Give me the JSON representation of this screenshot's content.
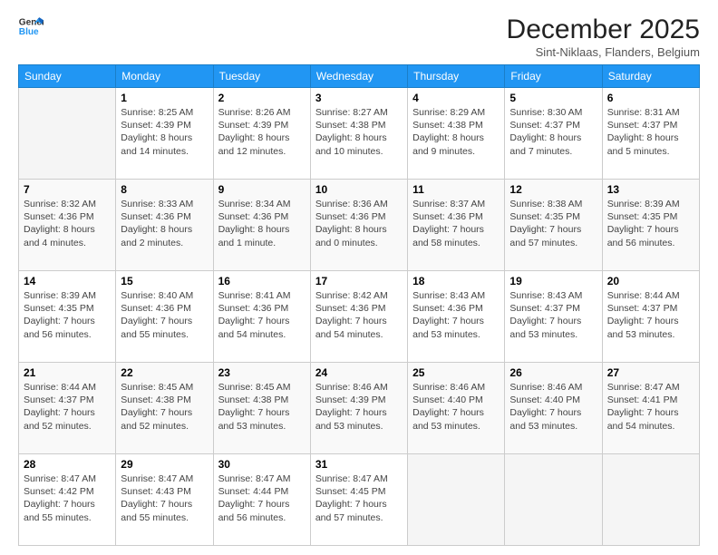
{
  "header": {
    "logo_line1": "General",
    "logo_line2": "Blue",
    "month": "December 2025",
    "location": "Sint-Niklaas, Flanders, Belgium"
  },
  "days_of_week": [
    "Sunday",
    "Monday",
    "Tuesday",
    "Wednesday",
    "Thursday",
    "Friday",
    "Saturday"
  ],
  "weeks": [
    [
      {
        "day": "",
        "info": ""
      },
      {
        "day": "1",
        "info": "Sunrise: 8:25 AM\nSunset: 4:39 PM\nDaylight: 8 hours\nand 14 minutes."
      },
      {
        "day": "2",
        "info": "Sunrise: 8:26 AM\nSunset: 4:39 PM\nDaylight: 8 hours\nand 12 minutes."
      },
      {
        "day": "3",
        "info": "Sunrise: 8:27 AM\nSunset: 4:38 PM\nDaylight: 8 hours\nand 10 minutes."
      },
      {
        "day": "4",
        "info": "Sunrise: 8:29 AM\nSunset: 4:38 PM\nDaylight: 8 hours\nand 9 minutes."
      },
      {
        "day": "5",
        "info": "Sunrise: 8:30 AM\nSunset: 4:37 PM\nDaylight: 8 hours\nand 7 minutes."
      },
      {
        "day": "6",
        "info": "Sunrise: 8:31 AM\nSunset: 4:37 PM\nDaylight: 8 hours\nand 5 minutes."
      }
    ],
    [
      {
        "day": "7",
        "info": "Sunrise: 8:32 AM\nSunset: 4:36 PM\nDaylight: 8 hours\nand 4 minutes."
      },
      {
        "day": "8",
        "info": "Sunrise: 8:33 AM\nSunset: 4:36 PM\nDaylight: 8 hours\nand 2 minutes."
      },
      {
        "day": "9",
        "info": "Sunrise: 8:34 AM\nSunset: 4:36 PM\nDaylight: 8 hours\nand 1 minute."
      },
      {
        "day": "10",
        "info": "Sunrise: 8:36 AM\nSunset: 4:36 PM\nDaylight: 8 hours\nand 0 minutes."
      },
      {
        "day": "11",
        "info": "Sunrise: 8:37 AM\nSunset: 4:36 PM\nDaylight: 7 hours\nand 58 minutes."
      },
      {
        "day": "12",
        "info": "Sunrise: 8:38 AM\nSunset: 4:35 PM\nDaylight: 7 hours\nand 57 minutes."
      },
      {
        "day": "13",
        "info": "Sunrise: 8:39 AM\nSunset: 4:35 PM\nDaylight: 7 hours\nand 56 minutes."
      }
    ],
    [
      {
        "day": "14",
        "info": "Sunrise: 8:39 AM\nSunset: 4:35 PM\nDaylight: 7 hours\nand 56 minutes."
      },
      {
        "day": "15",
        "info": "Sunrise: 8:40 AM\nSunset: 4:36 PM\nDaylight: 7 hours\nand 55 minutes."
      },
      {
        "day": "16",
        "info": "Sunrise: 8:41 AM\nSunset: 4:36 PM\nDaylight: 7 hours\nand 54 minutes."
      },
      {
        "day": "17",
        "info": "Sunrise: 8:42 AM\nSunset: 4:36 PM\nDaylight: 7 hours\nand 54 minutes."
      },
      {
        "day": "18",
        "info": "Sunrise: 8:43 AM\nSunset: 4:36 PM\nDaylight: 7 hours\nand 53 minutes."
      },
      {
        "day": "19",
        "info": "Sunrise: 8:43 AM\nSunset: 4:37 PM\nDaylight: 7 hours\nand 53 minutes."
      },
      {
        "day": "20",
        "info": "Sunrise: 8:44 AM\nSunset: 4:37 PM\nDaylight: 7 hours\nand 53 minutes."
      }
    ],
    [
      {
        "day": "21",
        "info": "Sunrise: 8:44 AM\nSunset: 4:37 PM\nDaylight: 7 hours\nand 52 minutes."
      },
      {
        "day": "22",
        "info": "Sunrise: 8:45 AM\nSunset: 4:38 PM\nDaylight: 7 hours\nand 52 minutes."
      },
      {
        "day": "23",
        "info": "Sunrise: 8:45 AM\nSunset: 4:38 PM\nDaylight: 7 hours\nand 53 minutes."
      },
      {
        "day": "24",
        "info": "Sunrise: 8:46 AM\nSunset: 4:39 PM\nDaylight: 7 hours\nand 53 minutes."
      },
      {
        "day": "25",
        "info": "Sunrise: 8:46 AM\nSunset: 4:40 PM\nDaylight: 7 hours\nand 53 minutes."
      },
      {
        "day": "26",
        "info": "Sunrise: 8:46 AM\nSunset: 4:40 PM\nDaylight: 7 hours\nand 53 minutes."
      },
      {
        "day": "27",
        "info": "Sunrise: 8:47 AM\nSunset: 4:41 PM\nDaylight: 7 hours\nand 54 minutes."
      }
    ],
    [
      {
        "day": "28",
        "info": "Sunrise: 8:47 AM\nSunset: 4:42 PM\nDaylight: 7 hours\nand 55 minutes."
      },
      {
        "day": "29",
        "info": "Sunrise: 8:47 AM\nSunset: 4:43 PM\nDaylight: 7 hours\nand 55 minutes."
      },
      {
        "day": "30",
        "info": "Sunrise: 8:47 AM\nSunset: 4:44 PM\nDaylight: 7 hours\nand 56 minutes."
      },
      {
        "day": "31",
        "info": "Sunrise: 8:47 AM\nSunset: 4:45 PM\nDaylight: 7 hours\nand 57 minutes."
      },
      {
        "day": "",
        "info": ""
      },
      {
        "day": "",
        "info": ""
      },
      {
        "day": "",
        "info": ""
      }
    ]
  ]
}
